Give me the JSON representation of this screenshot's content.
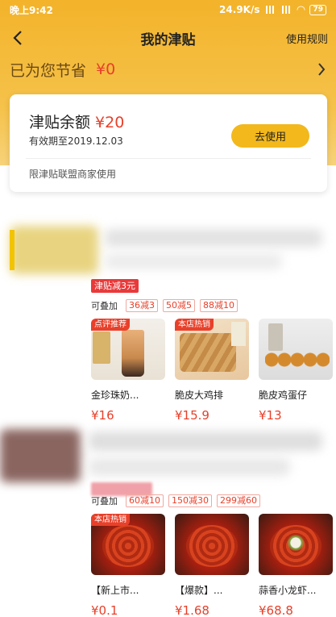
{
  "status_bar": {
    "time": "晚上9:42",
    "speed": "24.9K/s",
    "battery": "79"
  },
  "nav": {
    "title": "我的津贴",
    "rules": "使用规则"
  },
  "savings": {
    "label": "已为您节省",
    "value": "¥0"
  },
  "card": {
    "title": "津贴余额",
    "amount": "¥20",
    "expiry": "有效期至2019.12.03",
    "button": "去使用",
    "limit": "限津贴联盟商家使用"
  },
  "store1": {
    "allowance_tag": "津贴减3元",
    "stack_label": "可叠加",
    "coupons": [
      "36减3",
      "50减5",
      "88减10"
    ],
    "products": [
      {
        "tag": "点评推荐",
        "name": "金珍珠奶...",
        "price": "¥16"
      },
      {
        "tag": "本店热销",
        "name": "脆皮大鸡排",
        "price": "¥15.9"
      },
      {
        "tag": "",
        "name": "脆皮鸡蛋仔",
        "price": "¥13"
      }
    ]
  },
  "store2": {
    "stack_label": "可叠加",
    "coupons": [
      "60减10",
      "150减30",
      "299减60"
    ],
    "products": [
      {
        "tag": "本店热销",
        "name": "【新上市...",
        "price": "¥0.1"
      },
      {
        "tag": "",
        "name": "【爆款】...",
        "price": "¥1.68"
      },
      {
        "tag": "",
        "name": "蒜香小龙虾...",
        "price": "¥68.8"
      }
    ]
  },
  "colors": {
    "hero_yellow": "#f3b32a",
    "accent_red": "#e8402a",
    "button_yellow": "#f2b81c"
  },
  "icons": {
    "back": "chevron-left-icon",
    "savings_arrow": "chevron-right-icon"
  }
}
